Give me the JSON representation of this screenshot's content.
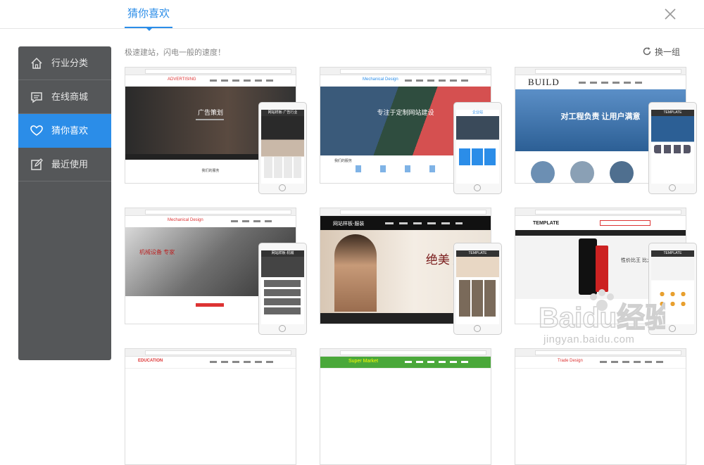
{
  "header": {
    "tab_label": "猜你喜欢"
  },
  "sidebar": {
    "items": [
      {
        "label": "行业分类",
        "icon": "home-icon"
      },
      {
        "label": "在线商城",
        "icon": "shop-icon"
      },
      {
        "label": "猜你喜欢",
        "icon": "heart-icon",
        "active": true
      },
      {
        "label": "最近使用",
        "icon": "edit-icon"
      }
    ]
  },
  "main": {
    "slogan": "极速建站，闪电一般的速度！",
    "refresh_label": "换一组"
  },
  "templates": [
    {
      "logo": "ADVERTISING",
      "hero_text": "广告策划",
      "footer_text": "我们的服务",
      "phone_title": "网站样板·广告行业",
      "hero_color": "#3a3a3a"
    },
    {
      "logo": "Mechanical Design",
      "hero_text": "专注于定制网站建设",
      "footer_text": "我们的服务",
      "phone_title": "企业站",
      "hero_color": "#4b6e8e"
    },
    {
      "logo": "BUILD",
      "hero_text": "对工程负责 让用户满意",
      "footer_text": "",
      "phone_title": "TEMPLATE",
      "hero_color": "#2c6aa8"
    },
    {
      "logo": "Mechanical Design",
      "hero_text": "机械设备 专家",
      "footer_text": "",
      "phone_title": "网站样板·机械",
      "hero_color": "#9a9a9a"
    },
    {
      "logo": "网站样板-服装",
      "hero_text": "绝美 盛放",
      "footer_text": "",
      "phone_title": "TEMPLATE",
      "hero_color": "#e8d9c5"
    },
    {
      "logo": "TEMPLATE",
      "hero_text": "性价比王 比大屏更",
      "footer_text": "",
      "phone_title": "TEMPLATE",
      "hero_color": "#f2f2f2"
    },
    {
      "logo": "EDUCATION",
      "hero_text": "",
      "footer_text": "",
      "phone_title": "",
      "hero_color": "#ffffff"
    },
    {
      "logo": "Super Market",
      "hero_text": "",
      "footer_text": "",
      "phone_title": "",
      "hero_color": "#4aa83a"
    },
    {
      "logo": "Trade Design",
      "hero_text": "",
      "footer_text": "",
      "phone_title": "",
      "hero_color": "#ffffff"
    }
  ],
  "watermark": {
    "brand": "Baidu经验",
    "url": "jingyan.baidu.com"
  }
}
